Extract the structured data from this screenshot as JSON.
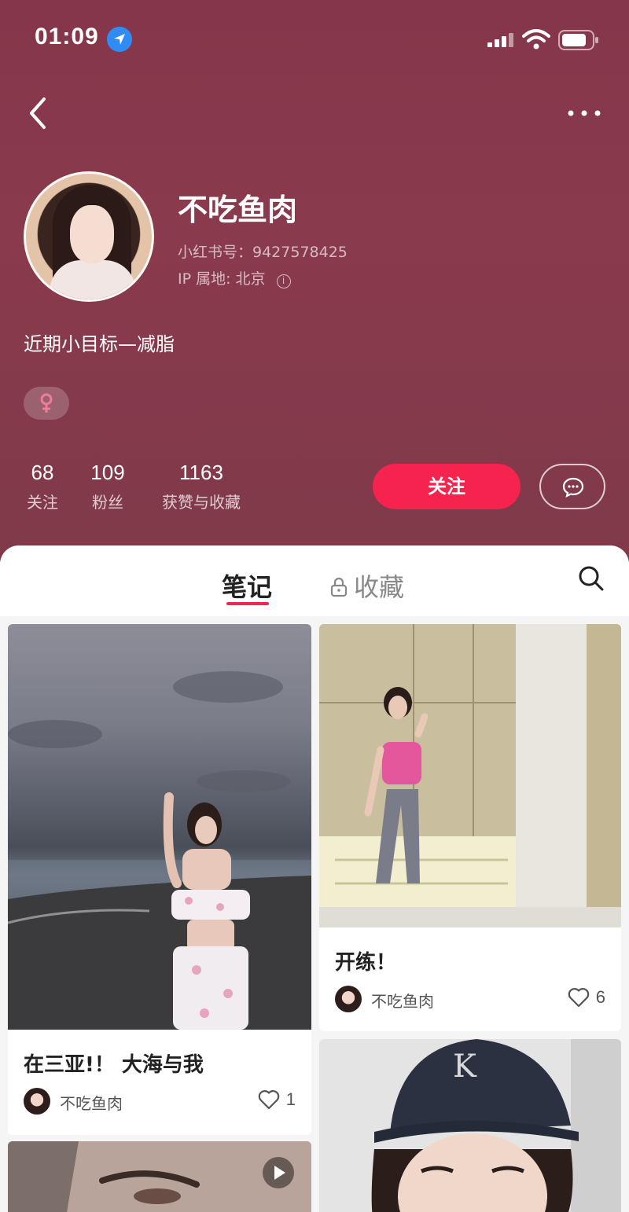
{
  "status_bar": {
    "time": "01:09"
  },
  "profile": {
    "nickname": "不吃鱼肉",
    "red_id": "小红书号：9427578425",
    "ip_location": "IP 属地: 北京",
    "bio": "近期小目标—减脂"
  },
  "stats": [
    {
      "value": "68",
      "label": "关注"
    },
    {
      "value": "109",
      "label": "粉丝"
    },
    {
      "value": "1163",
      "label": "获赞与收藏"
    }
  ],
  "actions": {
    "follow_label": "关注"
  },
  "tabs": {
    "notes": "笔记",
    "collections": "收藏"
  },
  "notes": [
    {
      "title": "在三亚!！ 大海与我",
      "author": "不吃鱼肉",
      "likes": "1"
    },
    {
      "title": "开练！",
      "author": "不吃鱼肉",
      "likes": "6"
    }
  ],
  "colors": {
    "header_bg": "#86364a",
    "accent": "#f5234d",
    "location_badge": "#2f8cf5"
  },
  "icons": [
    "back-icon",
    "more-icon",
    "location-icon",
    "signal-icon",
    "wifi-icon",
    "battery-icon",
    "info-icon",
    "female-icon",
    "message-icon",
    "lock-icon",
    "search-icon",
    "heart-icon",
    "video-play-icon"
  ]
}
